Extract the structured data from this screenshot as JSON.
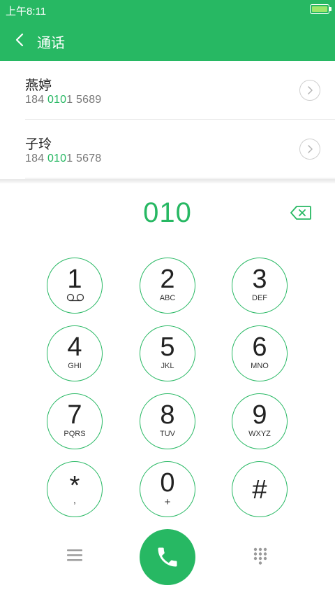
{
  "status_bar": {
    "time": "上午8:11",
    "battery_level": 1.0
  },
  "app_bar": {
    "title": "通话",
    "back_icon": "chevron-left-icon"
  },
  "contacts": [
    {
      "name": "燕婷",
      "number_prefix": "184 ",
      "number_match": "010",
      "number_suffix": "1 5689"
    },
    {
      "name": "子玲",
      "number_prefix": "184 ",
      "number_match": "010",
      "number_suffix": "1 5678"
    }
  ],
  "dialer": {
    "entered": "010",
    "keys": [
      {
        "digit": "1",
        "sub": ""
      },
      {
        "digit": "2",
        "sub": "ABC"
      },
      {
        "digit": "3",
        "sub": "DEF"
      },
      {
        "digit": "4",
        "sub": "GHI"
      },
      {
        "digit": "5",
        "sub": "JKL"
      },
      {
        "digit": "6",
        "sub": "MNO"
      },
      {
        "digit": "7",
        "sub": "PQRS"
      },
      {
        "digit": "8",
        "sub": "TUV"
      },
      {
        "digit": "9",
        "sub": "WXYZ"
      },
      {
        "digit": "*",
        "sub": ","
      },
      {
        "digit": "0",
        "sub": "+"
      },
      {
        "digit": "#",
        "sub": ""
      }
    ]
  },
  "colors": {
    "accent": "#27b863",
    "text": "#222222",
    "muted": "#777777"
  }
}
